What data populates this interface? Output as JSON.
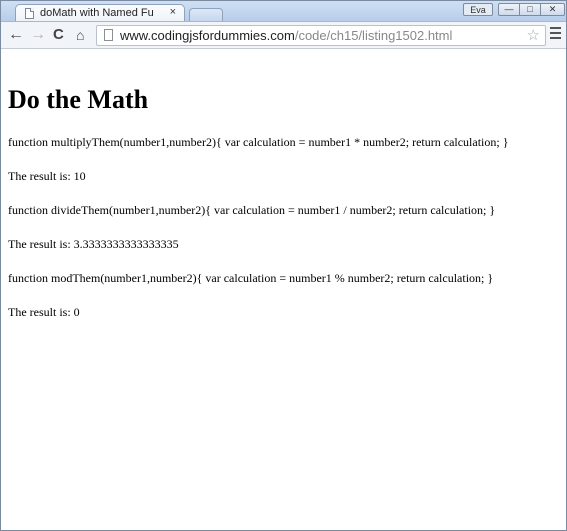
{
  "browser": {
    "tab_title": "doMath with Named Fu",
    "tab_close": "×",
    "user": "Eva",
    "window_min": "—",
    "window_max": "□",
    "window_close": "✕",
    "url_host": "www.codingjsfordummies.com",
    "url_path": "/code/ch15/listing1502.html",
    "icons": {
      "back": "←",
      "forward": "→",
      "reload": "C",
      "home": "⌂",
      "star": "☆"
    }
  },
  "page": {
    "heading": "Do the Math",
    "lines": [
      "function multiplyThem(number1,number2){ var calculation = number1 * number2; return calculation; }",
      "The result is: 10",
      "function divideThem(number1,number2){ var calculation = number1 / number2; return calculation; }",
      "The result is: 3.3333333333333335",
      "function modThem(number1,number2){ var calculation = number1 % number2; return calculation; }",
      "The result is: 0"
    ]
  }
}
